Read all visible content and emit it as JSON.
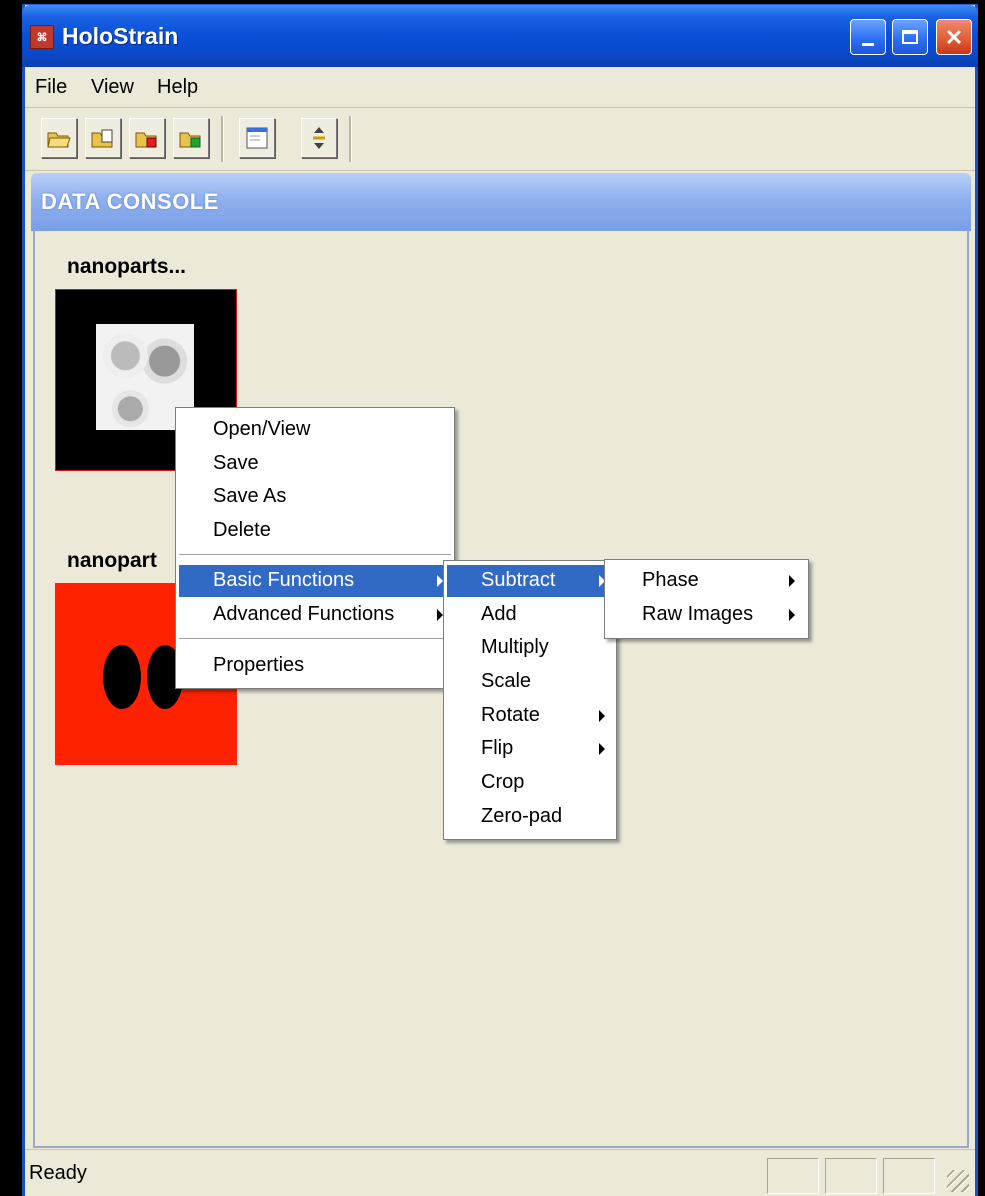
{
  "window": {
    "title": "HoloStrain"
  },
  "menubar": {
    "items": [
      "File",
      "View",
      "Help"
    ]
  },
  "toolbar": {
    "icons": [
      "open-folder-icon",
      "open-multiple-icon",
      "remove-file-icon",
      "add-file-icon",
      "window-icon",
      "adjust-icon"
    ]
  },
  "console": {
    "header": "DATA CONSOLE",
    "items": [
      {
        "label": "nanoparts..."
      },
      {
        "label": "nanopart"
      }
    ]
  },
  "context_menu": {
    "items": [
      "Open/View",
      "Save",
      "Save As",
      "Delete",
      "Basic Functions",
      "Advanced Functions",
      "Properties"
    ],
    "selected": "Basic Functions"
  },
  "basic_menu": {
    "items": [
      "Subtract",
      "Add",
      "Multiply",
      "Scale",
      "Rotate",
      "Flip",
      "Crop",
      "Zero-pad"
    ],
    "selected": "Subtract"
  },
  "subtract_menu": {
    "items": [
      "Phase",
      "Raw Images"
    ]
  },
  "statusbar": {
    "text": "Ready"
  },
  "colors": {
    "titlebar": "#0a50d8",
    "selection": "#316ac5",
    "thumbnail_red": "#ff2200"
  }
}
